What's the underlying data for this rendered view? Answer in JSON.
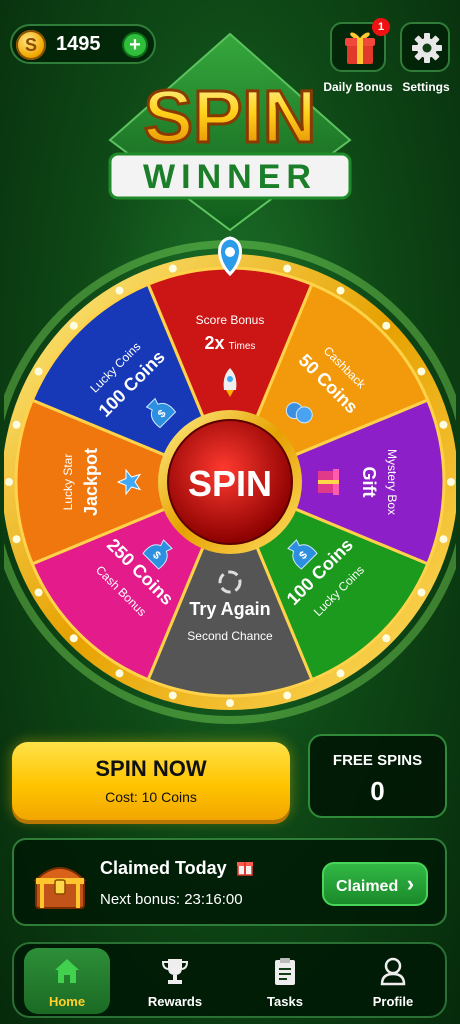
{
  "topbar": {
    "coin_symbol": "S",
    "coin_balance": "1495",
    "add_coins_symbol": "+",
    "daily_bonus_label": "Daily Bonus",
    "daily_bonus_badge": "1",
    "settings_label": "Settings"
  },
  "logo": {
    "line1": "SPIN",
    "line2": "WINNER"
  },
  "wheel": {
    "center_label": "SPIN",
    "segments": [
      {
        "title": "Score Bonus",
        "value": "2x",
        "suffix": "Times",
        "color": "#cc1616",
        "icon": "rocket-icon"
      },
      {
        "title": "Cashback",
        "value": "50 Coins",
        "color": "#f29a0c",
        "icon": "coin-stack-icon"
      },
      {
        "title": "Mystery Box",
        "value": "Gift",
        "color": "#8d1fc9",
        "icon": "gift-box-icon"
      },
      {
        "title": "Lucky Coins",
        "value": "100 Coins",
        "color": "#1c9a1e",
        "icon": "money-bag-icon"
      },
      {
        "title": "Second Chance",
        "value": "Try Again",
        "color": "#555555",
        "icon": "retry-icon"
      },
      {
        "title": "Cash Bonus",
        "value": "250 Coins",
        "color": "#e31b8b",
        "icon": "money-bag-icon"
      },
      {
        "title": "Lucky Star",
        "value": "Jackpot",
        "color": "#f0770d",
        "icon": "star-icon"
      },
      {
        "title": "Lucky Coins",
        "value": "100 Coins",
        "color": "#1739b8",
        "icon": "money-bag-icon"
      }
    ]
  },
  "actions": {
    "spin_now_label": "SPIN NOW",
    "spin_cost": "Cost: 10 Coins",
    "free_spins_label": "FREE SPINS",
    "free_spins_count": "0"
  },
  "claimed": {
    "title": "Claimed Today",
    "next_bonus": "Next bonus: 23:16:00",
    "button_label": "Claimed",
    "button_chevron": "›"
  },
  "nav": {
    "items": [
      {
        "label": "Home",
        "icon": "home-icon",
        "active": true
      },
      {
        "label": "Rewards",
        "icon": "trophy-icon",
        "active": false
      },
      {
        "label": "Tasks",
        "icon": "clipboard-icon",
        "active": false
      },
      {
        "label": "Profile",
        "icon": "profile-icon",
        "active": false
      }
    ]
  },
  "colors": {
    "accent_yellow": "#ffc400",
    "accent_green": "#2fbf3c",
    "wheel_rim": "#f5c53a"
  }
}
